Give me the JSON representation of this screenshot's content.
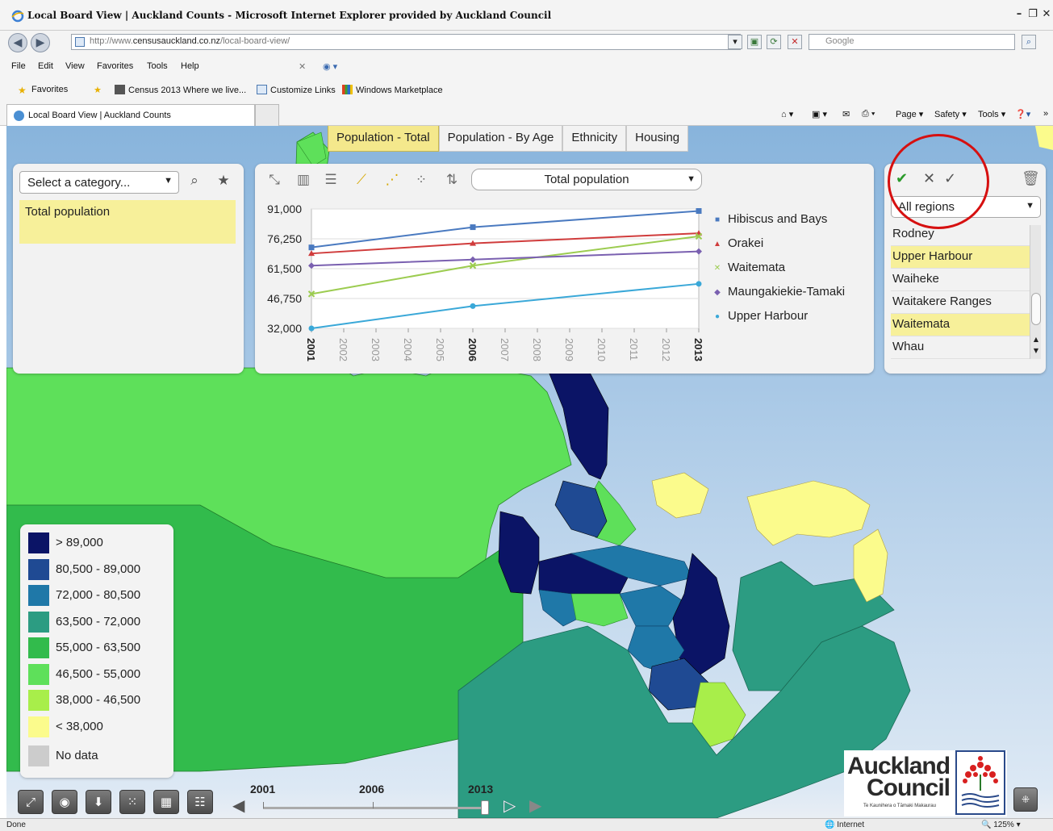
{
  "browser": {
    "window_title": "Local Board View | Auckland Counts - Microsoft Internet Explorer provided by Auckland Council",
    "url_prefix": "http://www.",
    "url_domain": "censusauckland.co.nz",
    "url_path": "/local-board-view/",
    "search_placeholder": "Google",
    "menu": [
      "File",
      "Edit",
      "View",
      "Favorites",
      "Tools",
      "Help"
    ],
    "favorites_label": "Favorites",
    "favorites_links": [
      "Census 2013 Where we live...",
      "Customize Links",
      "Windows Marketplace"
    ],
    "tab_title": "Local Board View | Auckland Counts",
    "command_bar": [
      "Page",
      "Safety",
      "Tools"
    ],
    "status_text": "Done",
    "status_zone": "Internet",
    "zoom": "125%"
  },
  "app": {
    "nav_tabs": [
      {
        "label": "Population - Total",
        "active": true
      },
      {
        "label": "Population - By Age",
        "active": false
      },
      {
        "label": "Ethnicity",
        "active": false
      },
      {
        "label": "Housing",
        "active": false
      }
    ],
    "category_panel": {
      "select_label": "Select a category...",
      "selected_item": "Total population"
    },
    "chart_panel": {
      "metric_select": "Total population",
      "tools": [
        "scatter-tool-icon",
        "column-chart-icon",
        "bar-chart-icon",
        "line-chart-icon",
        "area-chart-icon",
        "bubble-chart-icon",
        "sort-icon"
      ]
    },
    "region_panel": {
      "select_label": "All regions",
      "items": [
        {
          "label": "Rodney",
          "selected": false
        },
        {
          "label": "Upper Harbour",
          "selected": true
        },
        {
          "label": "Waiheke",
          "selected": false
        },
        {
          "label": "Waitakere Ranges",
          "selected": false
        },
        {
          "label": "Waitemata",
          "selected": true
        },
        {
          "label": "Whau",
          "selected": false
        }
      ]
    },
    "map_legend": [
      {
        "label": "> 89,000",
        "color": "#0b1466"
      },
      {
        "label": "80,500 - 89,000",
        "color": "#1f4a93"
      },
      {
        "label": "72,000 - 80,500",
        "color": "#1f78a8"
      },
      {
        "label": "63,500 - 72,000",
        "color": "#2c9c82"
      },
      {
        "label": "55,000 - 63,500",
        "color": "#32bb4c"
      },
      {
        "label": "46,500 - 55,000",
        "color": "#5ee05a"
      },
      {
        "label": "38,000 - 46,500",
        "color": "#a8ee4a"
      },
      {
        "label": "< 38,000",
        "color": "#fbfb8c"
      },
      {
        "label": "No data",
        "color": "#cccccc"
      }
    ],
    "timeline": {
      "years": [
        "2001",
        "2006",
        "2013"
      ],
      "current": "2013"
    },
    "council_logo": {
      "line1": "Auckland",
      "line2": "Council",
      "sub": "Te Kaunihera o Tāmaki Makaurau"
    }
  },
  "chart_data": {
    "type": "line",
    "title": "",
    "xlabel": "",
    "ylabel": "",
    "x": [
      "2001",
      "2002",
      "2003",
      "2004",
      "2005",
      "2006",
      "2007",
      "2008",
      "2009",
      "2010",
      "2011",
      "2012",
      "2013"
    ],
    "y_ticks": [
      "91,000",
      "76,250",
      "61,500",
      "46,750",
      "32,000"
    ],
    "ylim": [
      32000,
      91000
    ],
    "x_points": [
      "2001",
      "2006",
      "2013"
    ],
    "series": [
      {
        "name": "Hibiscus and Bays",
        "color": "#4a7ac0",
        "marker": "square",
        "values": [
          72000,
          82000,
          90000
        ]
      },
      {
        "name": "Orakei",
        "color": "#d03c3c",
        "marker": "triangle",
        "values": [
          69000,
          74000,
          79000
        ]
      },
      {
        "name": "Waitemata",
        "color": "#9ccc50",
        "marker": "x",
        "values": [
          49000,
          63000,
          77500
        ]
      },
      {
        "name": "Maungakiekie-Tamaki",
        "color": "#7a60b0",
        "marker": "diamond",
        "values": [
          63000,
          66000,
          70000
        ]
      },
      {
        "name": "Upper Harbour",
        "color": "#3aa8d8",
        "marker": "circle",
        "values": [
          32000,
          43000,
          54000
        ]
      }
    ],
    "legend_position": "right",
    "grid": true
  }
}
